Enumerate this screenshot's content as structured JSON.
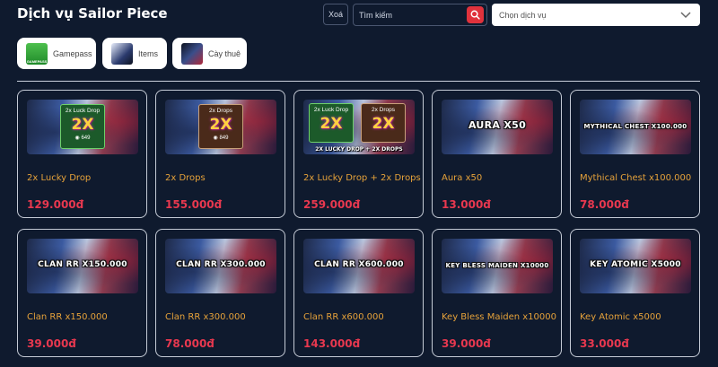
{
  "header": {
    "title": "Dịch vụ Sailor Piece",
    "clear_label": "Xoá",
    "search_placeholder": "Tìm kiếm",
    "select_value": "Chọn dịch vụ"
  },
  "categories": [
    {
      "label": "Gamepass",
      "thumb_text": "GAMEPASS"
    },
    {
      "label": "Items"
    },
    {
      "label": "Cày thuê"
    }
  ],
  "products": [
    {
      "name": "2x Lucky Drop",
      "price": "129.000đ",
      "badges": [
        {
          "title": "2x Luck Drop",
          "big": "2X",
          "robux": "649"
        }
      ]
    },
    {
      "name": "2x Drops",
      "price": "155.000đ",
      "badges": [
        {
          "title": "2x Drops",
          "big": "2X",
          "robux": "849"
        }
      ]
    },
    {
      "name": "2x Lucky Drop + 2x Drops",
      "price": "259.000đ",
      "badges": [
        {
          "title": "2x Luck Drop",
          "big": "2X"
        },
        {
          "title": "2x Drops",
          "big": "2X"
        }
      ],
      "image_caption": "2X LUCKY DROP + 2X DROPS"
    },
    {
      "name": "Aura x50",
      "price": "13.000đ",
      "image_caption": "AURA X50"
    },
    {
      "name": "Mythical Chest x100.000",
      "price": "78.000đ",
      "image_caption": "MYTHICAL CHEST X100.000"
    },
    {
      "name": "Clan RR x150.000",
      "price": "39.000đ",
      "image_caption": "CLAN RR X150.000"
    },
    {
      "name": "Clan RR x300.000",
      "price": "78.000đ",
      "image_caption": "CLAN RR X300.000"
    },
    {
      "name": "Clan RR x600.000",
      "price": "143.000đ",
      "image_caption": "CLAN RR X600.000"
    },
    {
      "name": "Key Bless Maiden x10000",
      "price": "39.000đ",
      "image_caption": "KEY BLESS MAIDEN X10000"
    },
    {
      "name": "Key Atomic x5000",
      "price": "33.000đ",
      "image_caption": "KEY ATOMIC X5000"
    }
  ],
  "colors": {
    "background": "#0f1a2e",
    "product_name": "#e6a23a",
    "price": "#e8384f",
    "search_button": "#e0323c"
  }
}
